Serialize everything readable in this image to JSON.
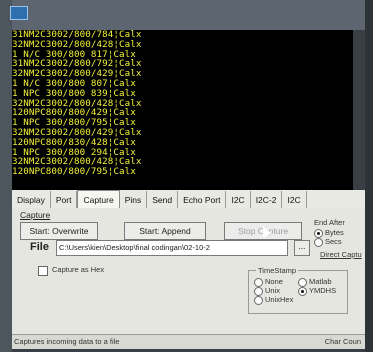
{
  "terminal": {
    "lines": [
      "31NM2C3002/800/784¦Calx",
      "32NM2C3002/800/428¦Calx",
      "1 N/C 300/800 817¦Calx",
      "31NM2C3002/800/792¦Calx",
      "32NM2C3002/800/429¦Calx",
      "1 N/C 300/800 807¦Calx",
      "1 NPC 300/800 839¦Calx",
      "32NM2C3002/800/428¦Calx",
      "120NPC800/800/429¦Calx",
      "1 NPC 300/800/795¦Calx",
      "32NM2C3002/800/429¦Calx",
      "120NPC800/830/428¦Calx",
      "1 NPC 300/800 294¦Calx",
      "32NM2C3002/800/428¦Calx",
      "120NPC800/800/795¦Calx"
    ]
  },
  "tabs": [
    "Display",
    "Port",
    "Capture",
    "Pins",
    "Send",
    "Echo Port",
    "I2C",
    "I2C-2",
    "I2C"
  ],
  "capture": {
    "group_label": "Capture",
    "start_overwrite": "Start: Overwrite",
    "start_append": "Start: Append",
    "stop_capture": "Stop Capture",
    "file_label": "File",
    "file_path": "C:\\Users\\kien\\Desktop\\final codingan\\02-10-2",
    "browse_label": "...",
    "capture_as_hex": "Capture as Hex"
  },
  "end_after": {
    "label": "End After",
    "options": [
      "Bytes",
      "Secs"
    ],
    "direct_capture": "Direct Captu"
  },
  "timestamp": {
    "label": "TimeStamp",
    "options_left": [
      "None",
      "Unix",
      "UnixHex"
    ],
    "options_right": [
      "Matlab",
      "YMDHS"
    ]
  },
  "status": {
    "left": "Captures incoming data to a file",
    "right": "Char Coun"
  }
}
